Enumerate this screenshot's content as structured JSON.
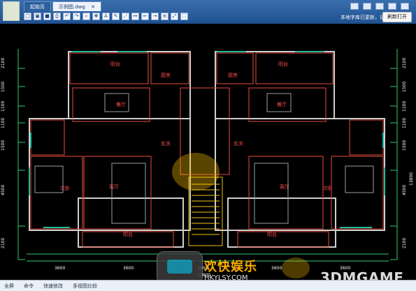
{
  "window": {
    "tabs": [
      {
        "label": "起始页"
      },
      {
        "label": "示例图.dwg"
      }
    ],
    "status_message": "本地字库已更新，请",
    "refresh_button": "刷新打开"
  },
  "toolbar": {
    "items": [
      "new",
      "open",
      "save",
      "print",
      "undo",
      "redo",
      "zoom",
      "pan",
      "text",
      "pencil",
      "line",
      "measure",
      "back",
      "forward",
      "layers",
      "fit",
      "full"
    ]
  },
  "drawing": {
    "rooms": {
      "yangtai_top_left": "阳台",
      "chufang_left": "厨房",
      "canting_left": "餐厅",
      "xuanguan_left": "玄关",
      "keting_left": "客厅",
      "ciwo_left": "次卧",
      "yangtai_bottom_left": "阳台",
      "yangtai_top_right": "阳台",
      "chufang_right": "厨房",
      "canting_right": "餐厅",
      "xuanguan_right": "玄关",
      "keting_right": "客厅",
      "ciwo_right": "次卧",
      "yangtai_bottom_right": "阳台"
    },
    "dims_left": [
      "2100",
      "1500",
      "1100",
      "1100",
      "1500",
      "4500",
      "2100"
    ],
    "dims_right": [
      "2100",
      "1500",
      "1100",
      "1100",
      "1500",
      "4500",
      "2100"
    ],
    "dims_bottom": [
      "3600",
      "3600",
      "3600",
      "3600",
      "3600"
    ],
    "dims_bottom_total": "13800",
    "dims_right_total": "13800"
  },
  "statusbar": {
    "items": [
      "全屏",
      "命令",
      "快速修改",
      "多视图比较"
    ]
  },
  "watermark": {
    "title": "欢快娱乐",
    "url": "HKYLSY.COM",
    "brand": "3DMGAME"
  }
}
